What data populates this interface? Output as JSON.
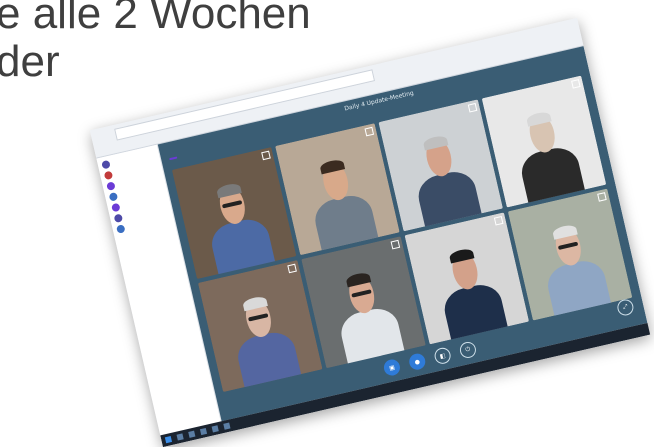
{
  "slide": {
    "line1": "e alle 2 Wochen",
    "line2": "der"
  },
  "meeting": {
    "title": "Daily 4 Update-Meeting"
  },
  "colors": {
    "app_bg": "#3a5d74",
    "accent": "#6b3bd6",
    "primary_button": "#2f7bd8"
  },
  "participants": [
    {
      "bg": "#6b5a4a",
      "skin": "#d9a98c",
      "shirt": "#4c6aa5",
      "hair": "#7a7a7a",
      "glasses": true
    },
    {
      "bg": "#b8a896",
      "skin": "#d8a98a",
      "shirt": "#6f7d8b",
      "hair": "#3b2b20",
      "glasses": false
    },
    {
      "bg": "#cdd1d4",
      "skin": "#d5a28a",
      "shirt": "#3a4c66",
      "hair": "#bfbfbf",
      "glasses": false
    },
    {
      "bg": "#e8e8e8",
      "skin": "#d8c4b2",
      "shirt": "#2a2a2a",
      "hair": "#d8d8d8",
      "glasses": false
    },
    {
      "bg": "#7d6a5c",
      "skin": "#d8b6a4",
      "shirt": "#5466a1",
      "hair": "#d9d9d9",
      "glasses": true
    },
    {
      "bg": "#6a6e6f",
      "skin": "#d9aa92",
      "shirt": "#e2e6ea",
      "hair": "#2a2420",
      "glasses": true
    },
    {
      "bg": "#d6d6d6",
      "skin": "#d3a18a",
      "shirt": "#1e2f4a",
      "hair": "#1a1a1a",
      "glasses": false
    },
    {
      "bg": "#a9b0a3",
      "skin": "#dcb7a3",
      "shirt": "#8fa6c4",
      "hair": "#e0e0e0",
      "glasses": true
    }
  ],
  "icons": {
    "camera": "camera-icon",
    "microphone": "microphone-icon",
    "screen_share": "screen-share-icon",
    "leave": "leave-icon",
    "fullscreen": "fullscreen-icon"
  }
}
